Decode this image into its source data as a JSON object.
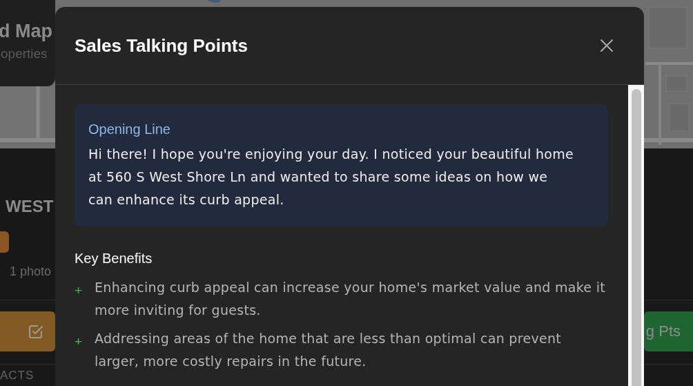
{
  "background": {
    "header_title": "d Map",
    "header_subtitle": "operties",
    "property_title": "WEST",
    "photo_count": "1 photo",
    "right_button": "g Pts",
    "section_label": "ACTS"
  },
  "modal": {
    "title": "Sales Talking Points",
    "opening": {
      "heading": "Opening Line",
      "text": "Hi there! I hope you're enjoying your day. I noticed your beautiful home at 560 S West Shore Ln and wanted to share some ideas on how we can enhance its curb appeal."
    },
    "benefits_heading": "Key Benefits",
    "benefits": [
      {
        "marker": "+",
        "text": "Enhancing curb appeal can increase your home's market value and make it more inviting for guests."
      },
      {
        "marker": "+",
        "text": "Addressing areas of the home that are less than optimal can prevent larger, more costly repairs in the future."
      }
    ]
  }
}
